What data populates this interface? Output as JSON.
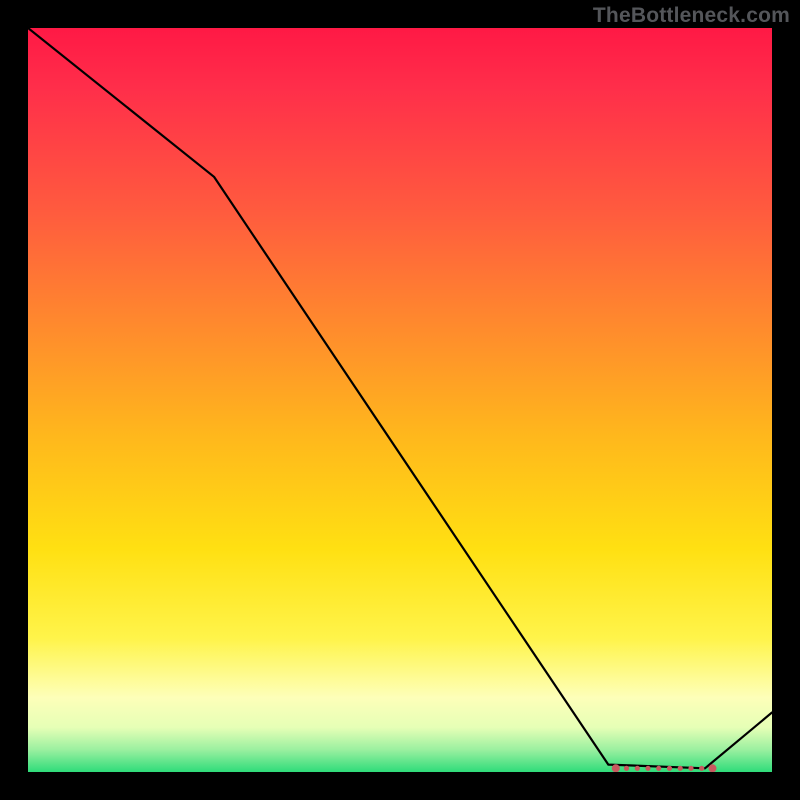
{
  "watermark": "TheBottleneck.com",
  "chart_data": {
    "type": "line",
    "title": "",
    "xlabel": "",
    "ylabel": "",
    "xlim": [
      0,
      100
    ],
    "ylim": [
      0,
      100
    ],
    "x": [
      0,
      25,
      78,
      91,
      100
    ],
    "values": [
      100,
      80,
      1,
      0.5,
      8
    ],
    "markers": {
      "x_range": [
        79,
        92
      ],
      "y": 0.5,
      "color": "#c8595f"
    }
  },
  "colors": {
    "background": "#000000",
    "line": "#000000",
    "marker": "#c8595f"
  }
}
